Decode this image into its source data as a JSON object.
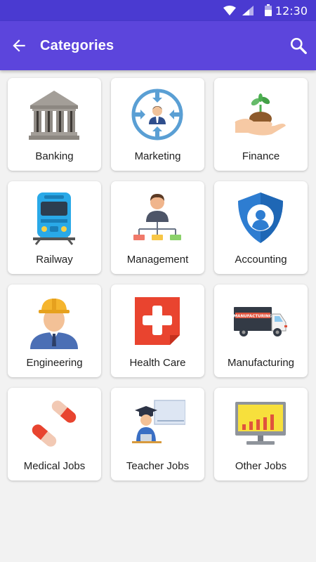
{
  "status_bar": {
    "time": "12:30"
  },
  "app_bar": {
    "title": "Categories",
    "back_icon": "arrow-back-icon",
    "search_icon": "search-icon"
  },
  "categories": [
    {
      "label": "Banking",
      "icon": "bank-building-icon"
    },
    {
      "label": "Marketing",
      "icon": "marketing-target-icon"
    },
    {
      "label": "Finance",
      "icon": "hand-plant-coin-icon"
    },
    {
      "label": "Railway",
      "icon": "train-icon"
    },
    {
      "label": "Management",
      "icon": "org-chart-person-icon"
    },
    {
      "label": "Accounting",
      "icon": "shield-person-icon"
    },
    {
      "label": "Engineering",
      "icon": "engineer-hardhat-icon"
    },
    {
      "label": "Health Care",
      "icon": "medical-cross-icon"
    },
    {
      "label": "Manufacturing",
      "icon": "delivery-truck-icon"
    },
    {
      "label": "Medical Jobs",
      "icon": "capsule-pills-icon"
    },
    {
      "label": "Teacher Jobs",
      "icon": "teacher-whiteboard-icon"
    },
    {
      "label": "Other Jobs",
      "icon": "monitor-chart-icon"
    }
  ],
  "truck_sign": "MANUFACTURING",
  "colors": {
    "status_bar": "#4a3ad1",
    "app_bar": "#5c45dc",
    "background": "#f2f2f2",
    "card": "#ffffff"
  }
}
